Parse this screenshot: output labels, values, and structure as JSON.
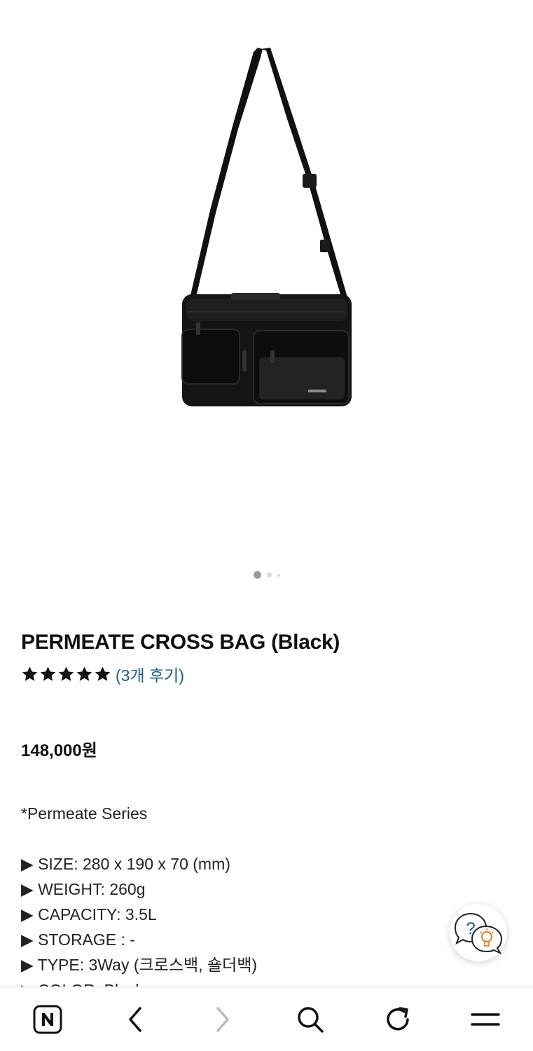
{
  "product": {
    "title": "PERMEATE CROSS BAG (Black)",
    "rating": 5,
    "rating_max": 5,
    "reviews_label": "(3개 후기)",
    "price": "148,000원",
    "series": "*Permeate Series",
    "specs": [
      "▶ SIZE: 280 x 190 x 70 (mm)",
      "▶ WEIGHT: 260g",
      "▶ CAPACITY: 3.5L",
      "▶ STORAGE : -",
      "▶ TYPE: 3Way (크로스백, 숄더백)",
      "▶ COLOR: Black"
    ]
  },
  "gallery": {
    "image_count": 3,
    "current_index": 1
  },
  "icons": {
    "help": "help-chat-icon",
    "home": "naver-home-icon",
    "back": "chevron-left-icon",
    "forward": "chevron-right-icon",
    "search": "search-icon",
    "refresh": "refresh-icon",
    "menu": "menu-icon"
  },
  "colors": {
    "review_link": "#1a5c8a",
    "forward_disabled": "#bbbbbb",
    "star": "#111111"
  }
}
